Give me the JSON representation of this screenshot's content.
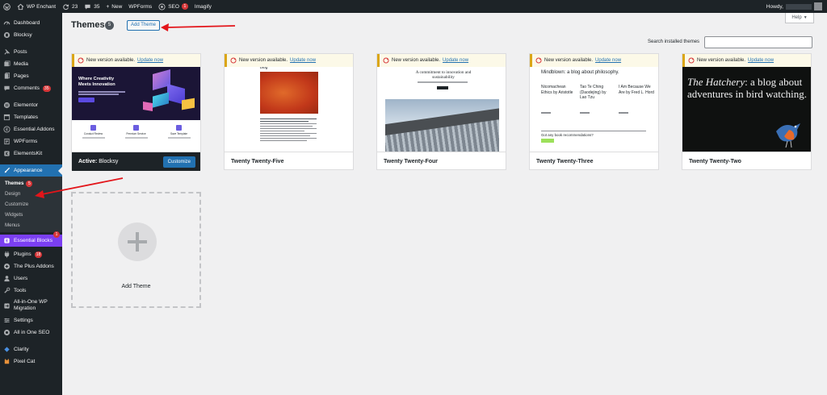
{
  "adminbar": {
    "site_name": "WP Enchant",
    "updates_count": "23",
    "comments_count": "35",
    "new_label": "New",
    "wpforms_label": "WPForms",
    "seo_label": "SEO",
    "seo_badge": "1",
    "imagify_label": "Imagify",
    "howdy_label": "Howdy,"
  },
  "sidebar": {
    "dashboard": "Dashboard",
    "blocksy": "Blocksy",
    "posts": "Posts",
    "media": "Media",
    "pages": "Pages",
    "comments": "Comments",
    "comments_badge": "35",
    "elementor": "Elementor",
    "templates": "Templates",
    "essential_addons": "Essential Addons",
    "wpforms": "WPForms",
    "elementskit": "ElementsKit",
    "appearance": "Appearance",
    "appearance_sub": {
      "themes": "Themes",
      "themes_badge": "5",
      "design": "Design",
      "customize": "Customize",
      "widgets": "Widgets",
      "menus": "Menus"
    },
    "essential_blocks": "Essential Blocks",
    "essential_blocks_badge": "1",
    "plugins": "Plugins",
    "plugins_badge": "18",
    "the_plus_addons": "The Plus Addons",
    "users": "Users",
    "tools": "Tools",
    "all_in_one_wp_migration_line1": "All-in-One WP",
    "all_in_one_wp_migration_line2": "Migration",
    "settings": "Settings",
    "all_in_one_seo": "All in One SEO",
    "clarity": "Clarity",
    "pixel_cat": "Pixel Cat"
  },
  "main": {
    "title": "Themes",
    "title_count": "5",
    "add_theme_button": "Add Theme",
    "help_button": "Help",
    "search_label": "Search installed themes",
    "search_value": "",
    "update_text": "New version available.",
    "update_link": "Update now",
    "themes": [
      {
        "name": "Blocksy",
        "active_label": "Active:",
        "customize_label": "Customize"
      },
      {
        "name": "Twenty Twenty-Five"
      },
      {
        "name": "Twenty Twenty-Four"
      },
      {
        "name": "Twenty Twenty-Three"
      },
      {
        "name": "Twenty Twenty-Two"
      }
    ],
    "add_theme_card_label": "Add Theme"
  },
  "previews": {
    "blocksy_headline": "Where Creativity Meets Innovation",
    "blocksy_features": [
      "Conduct Review",
      "Premium Service",
      "Save Template"
    ],
    "ttfour_headline": "A commitment to innovation and sustainability",
    "ttthree_title": "Mindblown: a blog about philosophy.",
    "ttthree_posts": [
      "Nicomachean Ethics by Aristotle",
      "Tao Te Ching (Daodejing) by Lao Tzu",
      "I Am Because We Are by Fred L. Hord"
    ],
    "ttthree_cta": "Got any book recommendations?",
    "tttwo_italic": "The Hatchery",
    "tttwo_rest": ": a blog about adventures in bird watching."
  },
  "colors": {
    "admin_dark": "#1d2327",
    "accent": "#2271b1",
    "badge_red": "#d63638",
    "essential_blocks": "#7b3ff2",
    "annotation_arrow": "#e3151a"
  }
}
